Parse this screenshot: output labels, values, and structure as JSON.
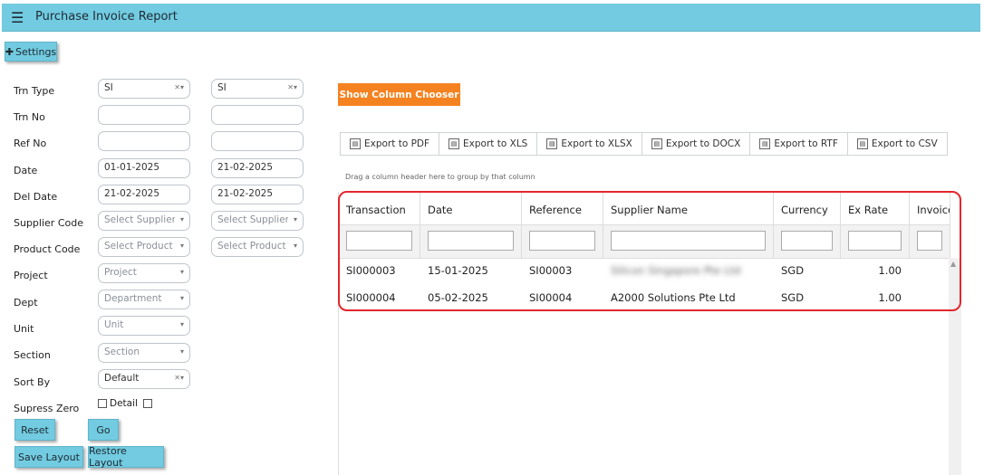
{
  "header": {
    "title": "Purchase Invoice Report",
    "menu_icon": "hamburger-icon"
  },
  "settings_button": "Settings",
  "form": {
    "trn_type": {
      "label": "Trn Type",
      "from": "SI",
      "to": "SI"
    },
    "trn_no": {
      "label": "Trn No",
      "from": "",
      "to": ""
    },
    "ref_no": {
      "label": "Ref No",
      "from": "",
      "to": ""
    },
    "date": {
      "label": "Date",
      "from": "01-01-2025",
      "to": "21-02-2025"
    },
    "del_date": {
      "label": "Del Date",
      "from": "21-02-2025",
      "to": "21-02-2025"
    },
    "supplier_code": {
      "label": "Supplier Code",
      "from_placeholder": "Select Supplier",
      "to_placeholder": "Select Supplier"
    },
    "product_code": {
      "label": "Product Code",
      "from_placeholder": "Select Product",
      "to_placeholder": "Select Product"
    },
    "project": {
      "label": "Project",
      "placeholder": "Project"
    },
    "dept": {
      "label": "Dept",
      "placeholder": "Department"
    },
    "unit": {
      "label": "Unit",
      "placeholder": "Unit"
    },
    "section": {
      "label": "Section",
      "placeholder": "Section"
    },
    "sort_by": {
      "label": "Sort By",
      "value": "Default"
    },
    "supress_zero": {
      "label": "Supress Zero",
      "detail_label": "Detail"
    }
  },
  "buttons": {
    "reset": "Reset",
    "go": "Go",
    "save_layout": "Save Layout",
    "restore_layout": "Restore Layout"
  },
  "column_chooser": "Show Column Chooser",
  "exports": [
    "Export to PDF",
    "Export to XLS",
    "Export to XLSX",
    "Export to DOCX",
    "Export to RTF",
    "Export to CSV"
  ],
  "group_hint": "Drag a column header here to group by that column",
  "grid": {
    "columns": [
      "Transaction",
      "Date",
      "Reference",
      "Supplier Name",
      "Currency",
      "Ex Rate",
      "Invoice"
    ],
    "rows": [
      {
        "transaction": "SI000003",
        "date": "15-01-2025",
        "reference": "SI00003",
        "supplier": "Silicon Singapore Pte Ltd",
        "currency": "SGD",
        "ex_rate": "1.00"
      },
      {
        "transaction": "SI000004",
        "date": "05-02-2025",
        "reference": "SI00004",
        "supplier": "A2000 Solutions Pte Ltd",
        "currency": "SGD",
        "ex_rate": "1.00"
      }
    ]
  },
  "colors": {
    "header_bg": "#72cbe0",
    "accent_orange": "#f58220",
    "highlight_red": "#e3262e"
  }
}
